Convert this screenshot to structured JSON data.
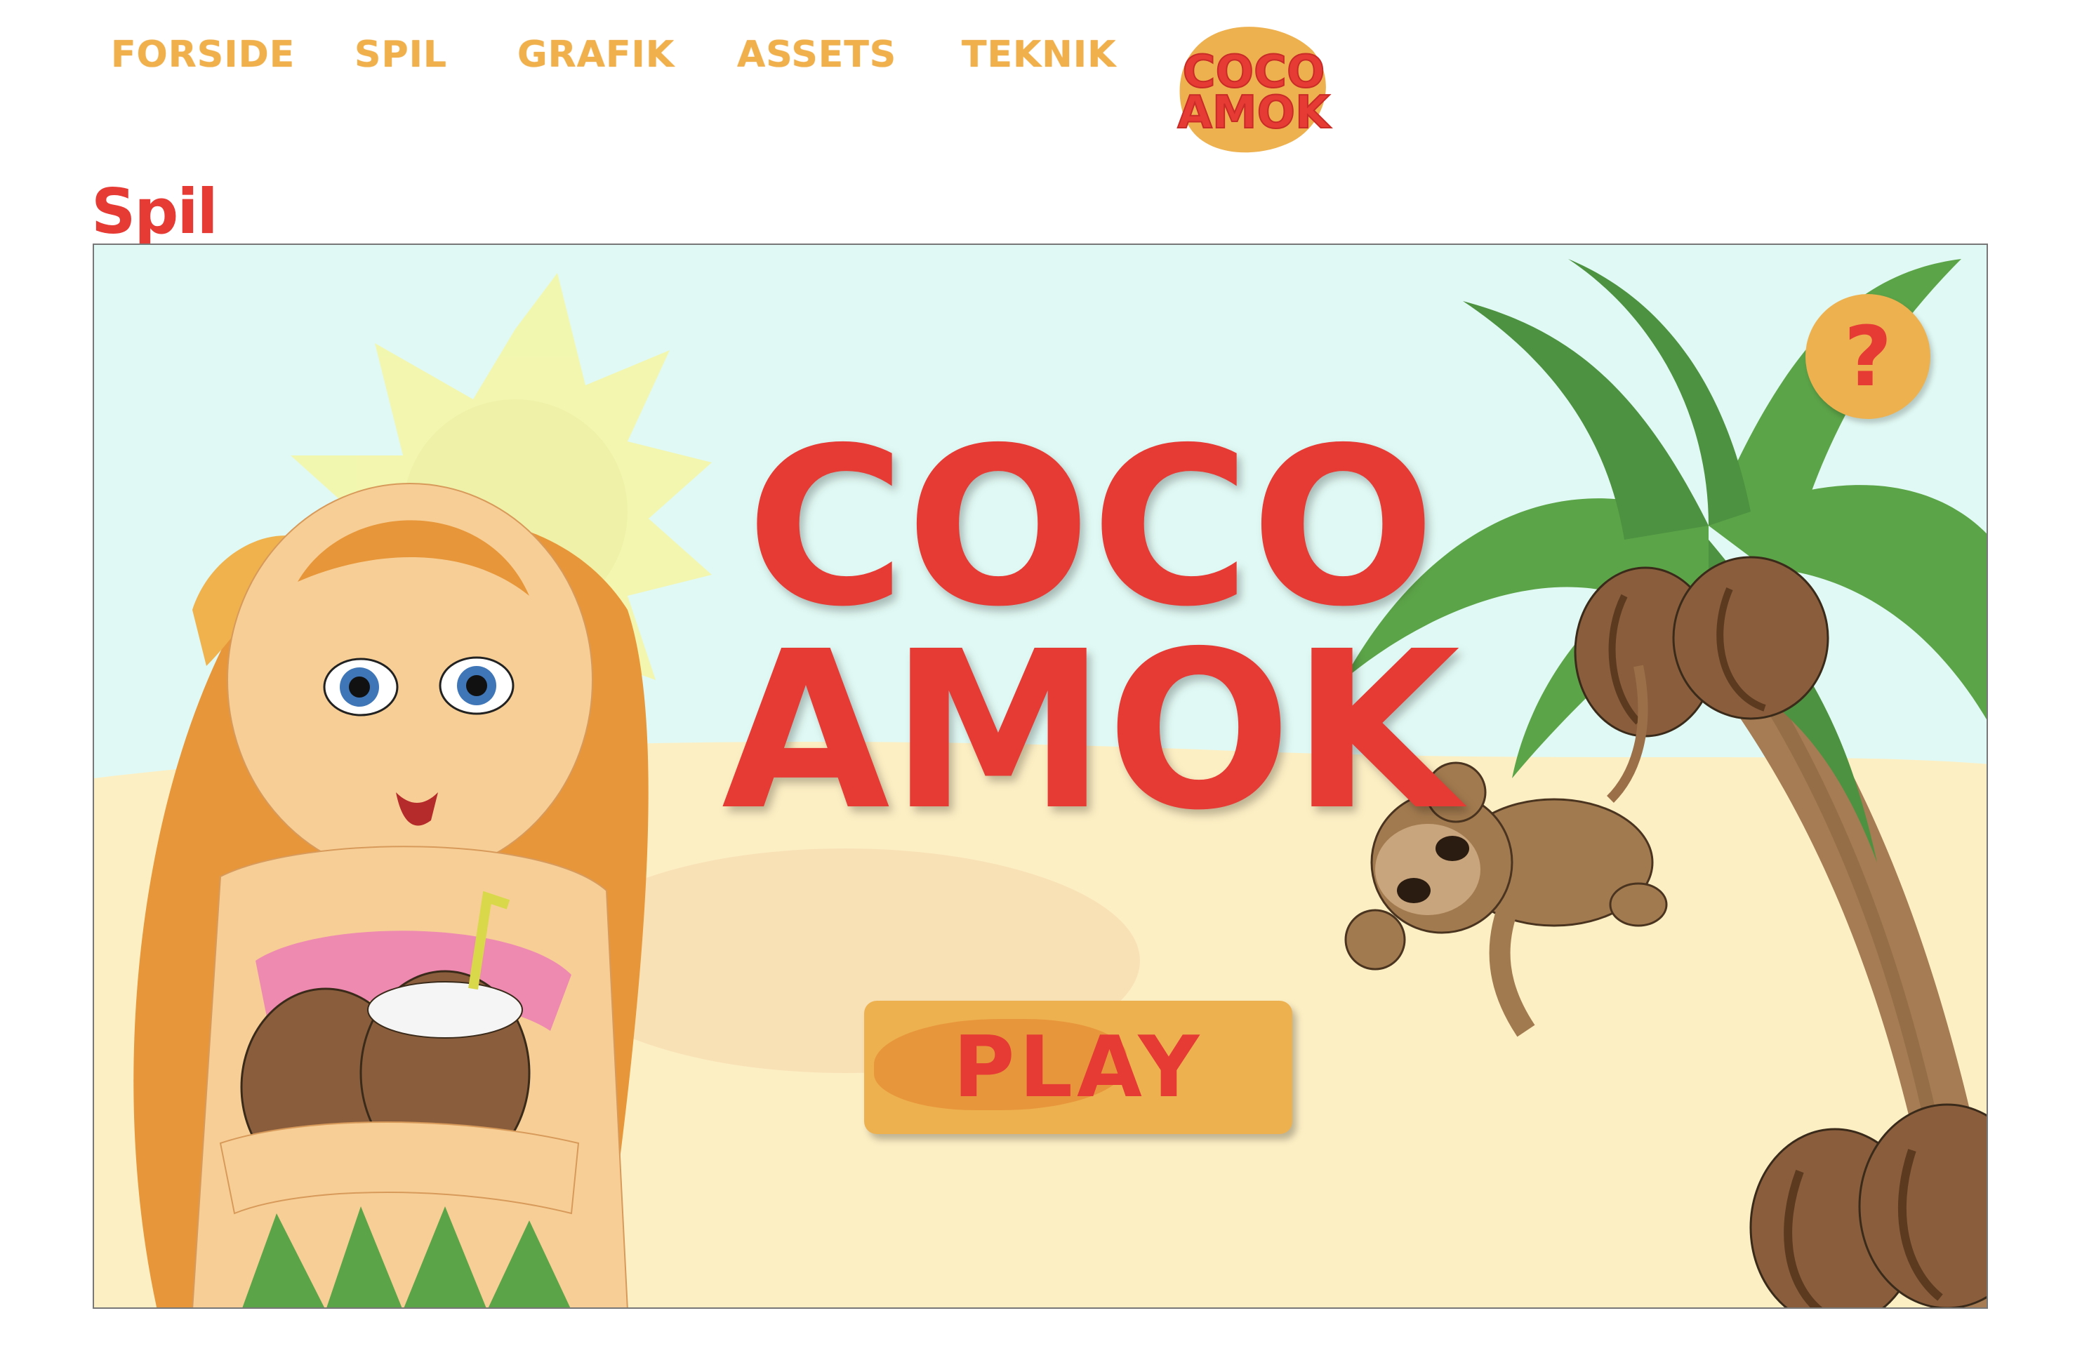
{
  "nav": {
    "items": [
      "FORSIDE",
      "SPIL",
      "GRAFIK",
      "ASSETS",
      "TEKNIK"
    ],
    "logo": {
      "line1": "COCO",
      "line2": "AMOK"
    }
  },
  "page": {
    "heading": "Spil"
  },
  "game": {
    "title": {
      "line1": "COCO",
      "line2": "AMOK"
    },
    "play_label": "PLAY",
    "help_label": "?"
  },
  "colors": {
    "accent_red": "#e63a35",
    "accent_orange": "#eeb150",
    "sky": "#e1f9f4",
    "sand": "#fdf0c8"
  }
}
